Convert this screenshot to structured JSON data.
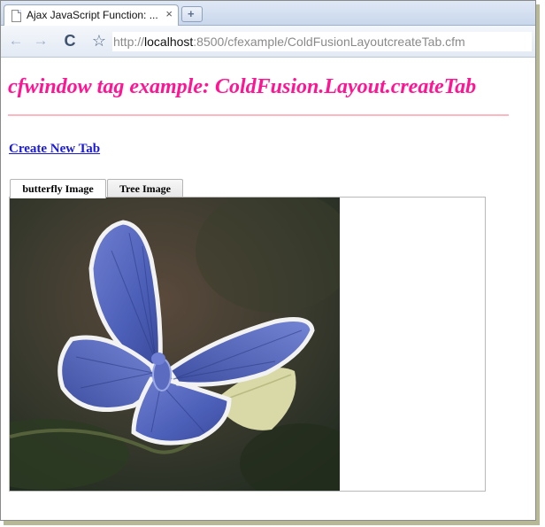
{
  "browser": {
    "tab_title": "Ajax JavaScript Function: ...",
    "tab_close_glyph": "×",
    "new_tab_glyph": "+",
    "back_glyph": "←",
    "forward_glyph": "→",
    "reload_glyph": "C",
    "star_glyph": "☆",
    "url_prefix": "http://",
    "url_host": "localhost",
    "url_path": ":8500/cfexample/ColdFusionLayoutcreateTab.cfm"
  },
  "page": {
    "title": "cfwindow tag example: ColdFusion.Layout.createTab",
    "create_link": "Create New Tab ",
    "title_color": "#ff1493",
    "rule_color": "#ffb6c1",
    "link_color": "#1a1ad8"
  },
  "layout_tabs": {
    "items": [
      {
        "label": "butterfly Image",
        "active": true
      },
      {
        "label": "Tree Image",
        "active": false
      }
    ]
  },
  "panel": {
    "image_icon": "butterfly-photo"
  }
}
